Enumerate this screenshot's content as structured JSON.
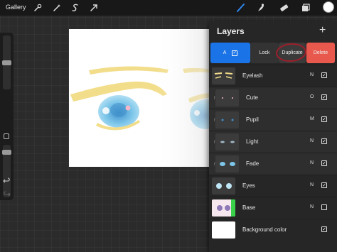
{
  "toolbar": {
    "gallery_label": "Gallery",
    "left_icons": [
      "wrench-icon",
      "magic-wand-icon",
      "selection-s-icon",
      "transform-arrow-icon"
    ],
    "right_icons": [
      "brush-icon",
      "smudge-icon",
      "eraser-icon",
      "layers-icon"
    ],
    "active_color": "#ffffff"
  },
  "canvas": {
    "background": "#ffffff",
    "colors": {
      "iris": "#7dc6ea",
      "lash": "#f2dd8a",
      "pupil": "#3f8fcb"
    }
  },
  "layers_panel": {
    "title": "Layers",
    "add_label": "+",
    "actions": {
      "selected_label": "A",
      "lock_label": "Lock",
      "duplicate_label": "Duplicate",
      "delete_label": "Delete"
    },
    "layers": [
      {
        "name": "Eyelash",
        "blend": "N",
        "visible": true
      },
      {
        "name": "Cute",
        "blend": "O",
        "visible": true
      },
      {
        "name": "Pupil",
        "blend": "M",
        "visible": true
      },
      {
        "name": "Light",
        "blend": "N",
        "visible": true
      },
      {
        "name": "Fade",
        "blend": "N",
        "visible": true
      },
      {
        "name": "Eyes",
        "blend": "N",
        "visible": true
      },
      {
        "name": "Base",
        "blend": "N",
        "visible": false
      },
      {
        "name": "Background color",
        "blend": "",
        "visible": true
      }
    ]
  },
  "colors": {
    "accent_blue": "#1a74e8",
    "delete_red": "#e8584c",
    "annotation_circle": "#9c1f2b"
  }
}
